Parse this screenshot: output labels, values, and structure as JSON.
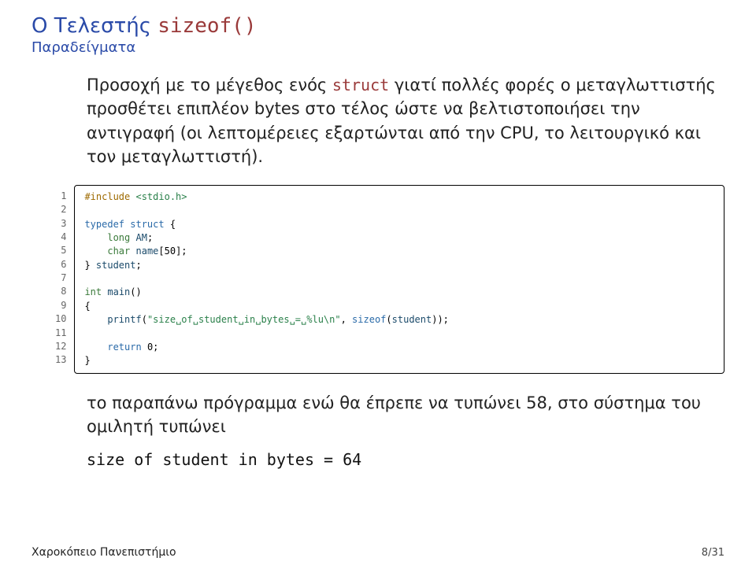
{
  "title": {
    "main_prefix": "Ο Τελεστής",
    "main_tt": "sizeof()",
    "subtitle": "Παραδείγματα"
  },
  "para1": {
    "seg1": "Προσοχή με το μέγεθος ενός ",
    "struct_kw": "struct",
    "seg2": " γιατί πολλές φορές ο μεταγλωττιστής προσθέτει επιπλέον bytes στο τέλος ώστε να βελτιστοποιήσει την αντιγραφή (οι λεπτομέρειες εξαρτώνται από την CPU, το λειτουργικό και τον μεταγλωττιστή)."
  },
  "code": {
    "linenos": "1\n2\n3\n4\n5\n6\n7\n8\n9\n10\n11\n12\n13",
    "l1a": "#include",
    "l1b": " <stdio.h>",
    "l3a": "typedef struct",
    "l3b": " {",
    "l4a": "    ",
    "l4b": "long",
    "l4c": " AM",
    "l4d": ";",
    "l5a": "    ",
    "l5b": "char",
    "l5c": " name",
    "l5d": "[50];",
    "l6a": "} ",
    "l6b": "student",
    "l6c": ";",
    "l8a": "int",
    "l8b": " main",
    "l8c": "()",
    "l9": "{",
    "l10a": "    ",
    "l10b": "printf",
    "l10c": "(",
    "l10d": "\"size␣of␣student␣in␣bytes␣=␣%lu\\n\"",
    "l10e": ", ",
    "l10f": "sizeof",
    "l10g": "(",
    "l10h": "student",
    "l10i": "));",
    "l12a": "    ",
    "l12b": "return",
    "l12c": " 0;",
    "l13": "}"
  },
  "para2": "το παραπάνω πρόγραμμα ενώ θα έπρεπε να τυπώνει 58, στο σύστημα του ομιλητή τυπώνει",
  "output_tt": "size of student in bytes = 64",
  "footer": {
    "left": "Χαροκόπειο Πανεπιστήμιο",
    "right": "8/31"
  }
}
